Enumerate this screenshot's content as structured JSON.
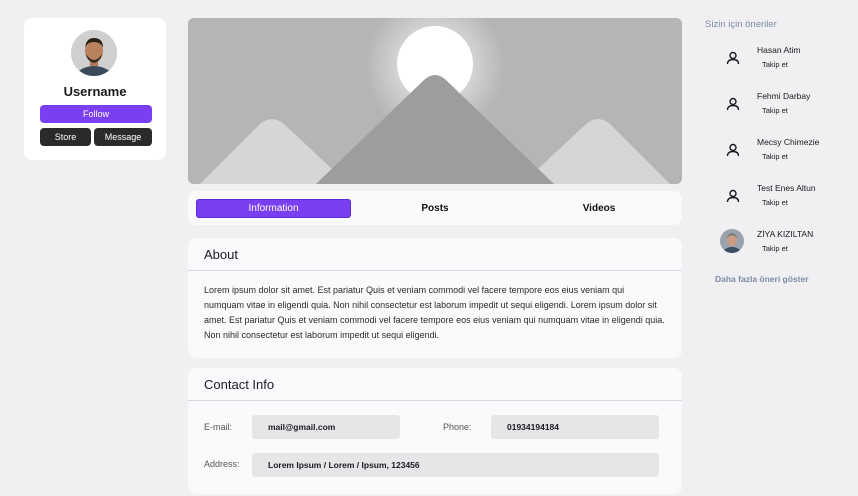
{
  "profile": {
    "username": "Username",
    "follow_label": "Follow",
    "store_label": "Store",
    "message_label": "Message"
  },
  "tabs": [
    {
      "label": "Information",
      "active": true
    },
    {
      "label": "Posts",
      "active": false
    },
    {
      "label": "Videos",
      "active": false
    }
  ],
  "about": {
    "title": "About",
    "text": "Lorem ipsum dolor sit amet. Est pariatur Quis et veniam commodi vel facere tempore eos eius veniam qui numquam vitae in eligendi quia. Non nihil consectetur est laborum impedit ut sequi eligendi. Lorem ipsum dolor sit amet. Est pariatur Quis et veniam commodi vel facere tempore eos eius veniam qui numquam vitae in eligendi quia. Non nihil consectetur est laborum impedit ut sequi eligendi."
  },
  "contact": {
    "title": "Contact Info",
    "email_label": "E-mail:",
    "email_value": "mail@gmail.com",
    "phone_label": "Phone:",
    "phone_value": "01934194184",
    "address_label": "Address:",
    "address_value": "Lorem Ipsum / Lorem / Ipsum, 123456"
  },
  "suggestions": {
    "title": "Sizin için öneriler",
    "people": [
      {
        "name": "Hasan Atim",
        "action": "Takip et",
        "icon": "user-icon"
      },
      {
        "name": "Fehmi Darbay",
        "action": "Takip et",
        "icon": "user-icon"
      },
      {
        "name": "Mecsy Chimezie",
        "action": "Takip et",
        "icon": "user-icon"
      },
      {
        "name": "Test Enes Altun",
        "action": "Takip et",
        "icon": "user-icon"
      },
      {
        "name": "ZİYA KIZILTAN",
        "action": "Takip et",
        "icon": "avatar-photo"
      }
    ],
    "more_label": "Daha fazla öneri göster"
  },
  "colors": {
    "accent": "#7b3ff2",
    "dark_button": "#2a2a2a",
    "muted_link": "#7e8aa8"
  }
}
